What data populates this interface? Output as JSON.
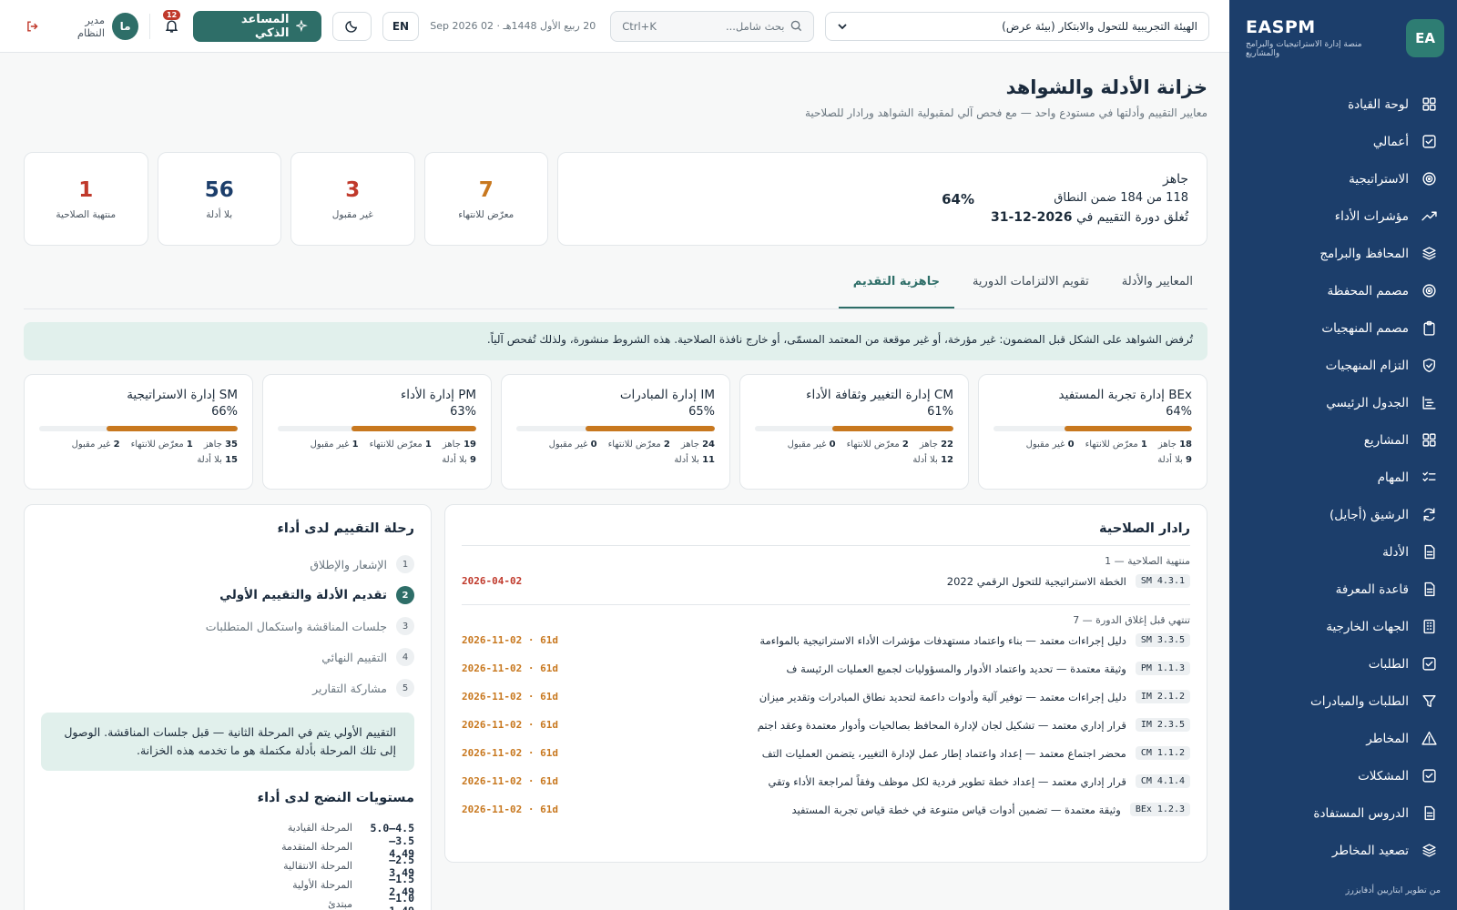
{
  "brand": {
    "name": "EASPM",
    "initials": "EA",
    "subtitle": "منصة إدارة الاستراتيجيات والبرامج والمشاريع"
  },
  "nav": [
    {
      "label": "لوحة القيادة",
      "icon": "grid-icon"
    },
    {
      "label": "أعمالي",
      "icon": "check-square-icon"
    },
    {
      "label": "الاستراتيجية",
      "icon": "target-icon"
    },
    {
      "label": "مؤشرات الأداء",
      "icon": "trend-up-icon"
    },
    {
      "label": "المحافظ والبرامج",
      "icon": "layers-icon"
    },
    {
      "label": "مصمم المحفظة",
      "icon": "target-icon"
    },
    {
      "label": "مصمم المنهجيات",
      "icon": "clipboard-icon"
    },
    {
      "label": "التزام المنهجيات",
      "icon": "shield-icon"
    },
    {
      "label": "الجدول الرئيسي",
      "icon": "gantt-icon"
    },
    {
      "label": "المشاريع",
      "icon": "grid-icon"
    },
    {
      "label": "المهام",
      "icon": "checklist-icon"
    },
    {
      "label": "الرشيق (أجايل)",
      "icon": "refresh-icon"
    },
    {
      "label": "الأدلة",
      "icon": "file-icon"
    },
    {
      "label": "قاعدة المعرفة",
      "icon": "file-icon"
    },
    {
      "label": "الجهات الخارجية",
      "icon": "building-icon"
    },
    {
      "label": "الطلبات",
      "icon": "check-square-icon"
    },
    {
      "label": "الطلبات والمبادرات",
      "icon": "filter-icon"
    },
    {
      "label": "المخاطر",
      "icon": "warning-icon"
    },
    {
      "label": "المشكلات",
      "icon": "check-square-icon"
    },
    {
      "label": "الدروس المستفادة",
      "icon": "file-icon"
    },
    {
      "label": "تصعيد المخاطر",
      "icon": "layers-icon"
    }
  ],
  "sidebar_footer": "من تطوير ابتاريين أدفايزرز",
  "topbar": {
    "org": "الهيئة التجريبية للتحول والابتكار (بيئة عرض)",
    "search_placeholder": "بحث شامل...",
    "search_shortcut": "Ctrl+K",
    "date": "20 ربيع الأول 1448هـ · 02 Sep 2026",
    "lang": "EN",
    "ai_label": "المساعد الذكي",
    "notif_count": "12",
    "user_initials": "ما",
    "user_name": "مدير النظام"
  },
  "page": {
    "title": "خزانة الأدلة والشواهد",
    "subtitle": "معايير التقييم وأدلتها في مستودع واحد — مع فحص آلي لمقبولية الشواهد ورادار للصلاحية"
  },
  "readiness": {
    "pct": "64%",
    "status": "جاهز",
    "count": "118 من 184 ضمن النطاق",
    "close_prefix": "تُغلق دورة التقييم في ",
    "close_date": "2026-12-31"
  },
  "stats": [
    {
      "value": "7",
      "label": "معرّض للانتهاء",
      "color": "#c8781f"
    },
    {
      "value": "3",
      "label": "غير مقبول",
      "color": "#c0392b"
    },
    {
      "value": "56",
      "label": "بلا أدلة",
      "color": "#1c3e6b"
    },
    {
      "value": "1",
      "label": "منتهية الصلاحية",
      "color": "#c0392b"
    }
  ],
  "tabs": [
    "المعايير والأدلة",
    "تقويم الالتزامات الدورية",
    "جاهزية التقديم"
  ],
  "notice": "تُرفض الشواهد على الشكل قبل المضمون: غير مؤرخة، أو غير موقعة من المعتمد المسمّى، أو خارج نافذة الصلاحية. هذه الشروط منشورة، ولذلك تُفحص آلياً.",
  "areas": [
    {
      "title": "BEx إدارة تجربة المستفيد",
      "pct": "64%",
      "fill": 0.64,
      "ready": "18",
      "ready_l": "جاهز",
      "exp": "1",
      "exp_l": "معرّض للانتهاء",
      "rej": "0",
      "rej_l": "غير مقبول",
      "none": "9",
      "none_l": "بلا أدلة"
    },
    {
      "title": "CM إدارة التغيير وثقافة الأداء",
      "pct": "61%",
      "fill": 0.61,
      "ready": "22",
      "ready_l": "جاهز",
      "exp": "2",
      "exp_l": "معرّض للانتهاء",
      "rej": "0",
      "rej_l": "غير مقبول",
      "none": "12",
      "none_l": "بلا أدلة"
    },
    {
      "title": "IM إدارة المبادرات",
      "pct": "65%",
      "fill": 0.65,
      "ready": "24",
      "ready_l": "جاهز",
      "exp": "2",
      "exp_l": "معرّض للانتهاء",
      "rej": "0",
      "rej_l": "غير مقبول",
      "none": "11",
      "none_l": "بلا أدلة"
    },
    {
      "title": "PM إدارة الأداء",
      "pct": "63%",
      "fill": 0.63,
      "ready": "19",
      "ready_l": "جاهز",
      "exp": "1",
      "exp_l": "معرّض للانتهاء",
      "rej": "1",
      "rej_l": "غير مقبول",
      "none": "9",
      "none_l": "بلا أدلة"
    },
    {
      "title": "SM إدارة الاستراتيجية",
      "pct": "66%",
      "fill": 0.66,
      "ready": "35",
      "ready_l": "جاهز",
      "exp": "1",
      "exp_l": "معرّض للانتهاء",
      "rej": "2",
      "rej_l": "غير مقبول",
      "none": "15",
      "none_l": "بلا أدلة"
    }
  ],
  "radar": {
    "title": "رادار الصلاحية",
    "expired_head": "منتهية الصلاحية — 1",
    "expired": [
      {
        "code": "SM 4.3.1",
        "title": "الخطة الاستراتيجية للتحول الرقمي 2022",
        "due": "2026-04-02"
      }
    ],
    "expiring_head": "تنتهي قبل إغلاق الدورة — 7",
    "expiring": [
      {
        "code": "SM 3.3.5",
        "title": "دليل إجراءات معتمد — بناء واعتماد مستهدفات مؤشرات الأداء الاستراتيجية بالمواءمة",
        "due": "2026-11-02 · 61d"
      },
      {
        "code": "PM 1.1.3",
        "title": "وثيقة معتمدة — تحديد واعتماد الأدوار والمسؤوليات لجميع العمليات الرئيسة ف",
        "due": "2026-11-02 · 61d"
      },
      {
        "code": "IM 2.1.2",
        "title": "دليل إجراءات معتمد — توفير آلية وأدوات داعمة لتحديد نطاق المبادرات وتقدير ميزان",
        "due": "2026-11-02 · 61d"
      },
      {
        "code": "IM 2.3.5",
        "title": "قرار إداري معتمد — تشكيل لجان لإدارة المحافظ بصالحيات وأدوار معتمدة وعقد اجتم",
        "due": "2026-11-02 · 61d"
      },
      {
        "code": "CM 1.1.2",
        "title": "محضر اجتماع معتمد — إعداد واعتماد إطار عمل لإدارة التغيير، يتضمن العمليات التف",
        "due": "2026-11-02 · 61d"
      },
      {
        "code": "CM 4.1.4",
        "title": "قرار إداري معتمد — إعداد خطة تطوير فردية لكل موظف وفقاً لمراجعة الأداء وتقي",
        "due": "2026-11-02 · 61d"
      },
      {
        "code": "BEx 1.2.3",
        "title": "وثيقة معتمدة — تضمين أدوات قياس متنوعة في خطة قياس تجربة المستفيد",
        "due": "2026-11-02 · 61d"
      }
    ]
  },
  "journey": {
    "title": "رحلة التقييم لدى أداء",
    "steps": [
      {
        "n": "1",
        "label": "الإشعار والإطلاق"
      },
      {
        "n": "2",
        "label": "تقديم الأدلة والتقييم الأولي",
        "current": true
      },
      {
        "n": "3",
        "label": "جلسات المناقشة واستكمال المتطلبات"
      },
      {
        "n": "4",
        "label": "التقييم النهائي"
      },
      {
        "n": "5",
        "label": "مشاركة التقارير"
      }
    ],
    "note": "التقييم الأولي يتم في المرحلة الثانية — قبل جلسات المناقشة. الوصول إلى تلك المرحلة بأدلة مكتملة هو ما تخدمه هذه الخزانة.",
    "levels_title": "مستويات النضج لدى أداء",
    "levels": [
      {
        "range": "4.5–5.0",
        "label": "المرحلة القيادية"
      },
      {
        "range": "3.5–4.49",
        "label": "المرحلة المتقدمة"
      },
      {
        "range": "2.5–3.49",
        "label": "المرحلة الانتقالية"
      },
      {
        "range": "1.5–2.49",
        "label": "المرحلة الأولية"
      },
      {
        "range": "1.0–1.49",
        "label": "مبتدئ"
      }
    ]
  }
}
